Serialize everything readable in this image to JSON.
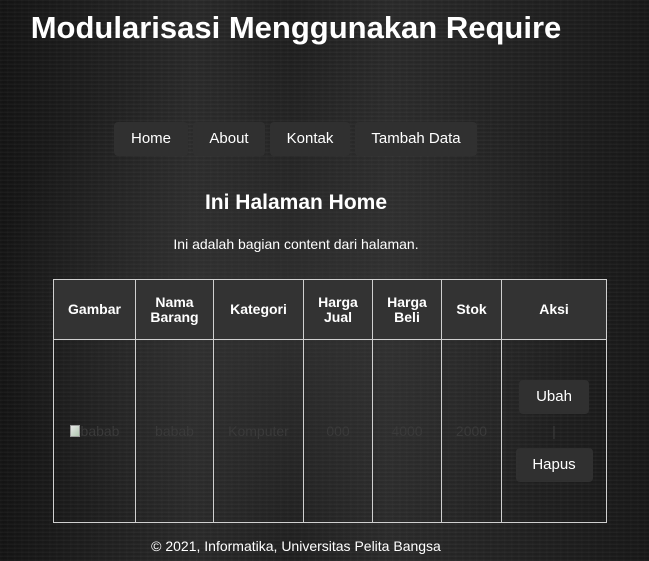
{
  "site": {
    "title": "Modularisasi Menggunakan Require"
  },
  "nav": {
    "items": [
      {
        "label": "Home"
      },
      {
        "label": "About"
      },
      {
        "label": "Kontak"
      },
      {
        "label": "Tambah Data"
      }
    ]
  },
  "main": {
    "heading": "Ini Halaman Home",
    "description": "Ini adalah bagian content dari halaman."
  },
  "table": {
    "headers": {
      "gambar": "Gambar",
      "nama": "Nama Barang",
      "kategori": "Kategori",
      "harga_jual": "Harga Jual",
      "harga_beli": "Harga Beli",
      "stok": "Stok",
      "aksi": "Aksi"
    },
    "rows": [
      {
        "gambar_alt": "babab",
        "nama": "babab",
        "kategori": "Komputer",
        "harga_jual": "000",
        "harga_beli": "4000",
        "stok": "2000",
        "ubah_label": "Ubah",
        "separator": "|",
        "hapus_label": "Hapus"
      }
    ]
  },
  "footer": {
    "text": "© 2021, Informatika, Universitas Pelita Bangsa"
  }
}
